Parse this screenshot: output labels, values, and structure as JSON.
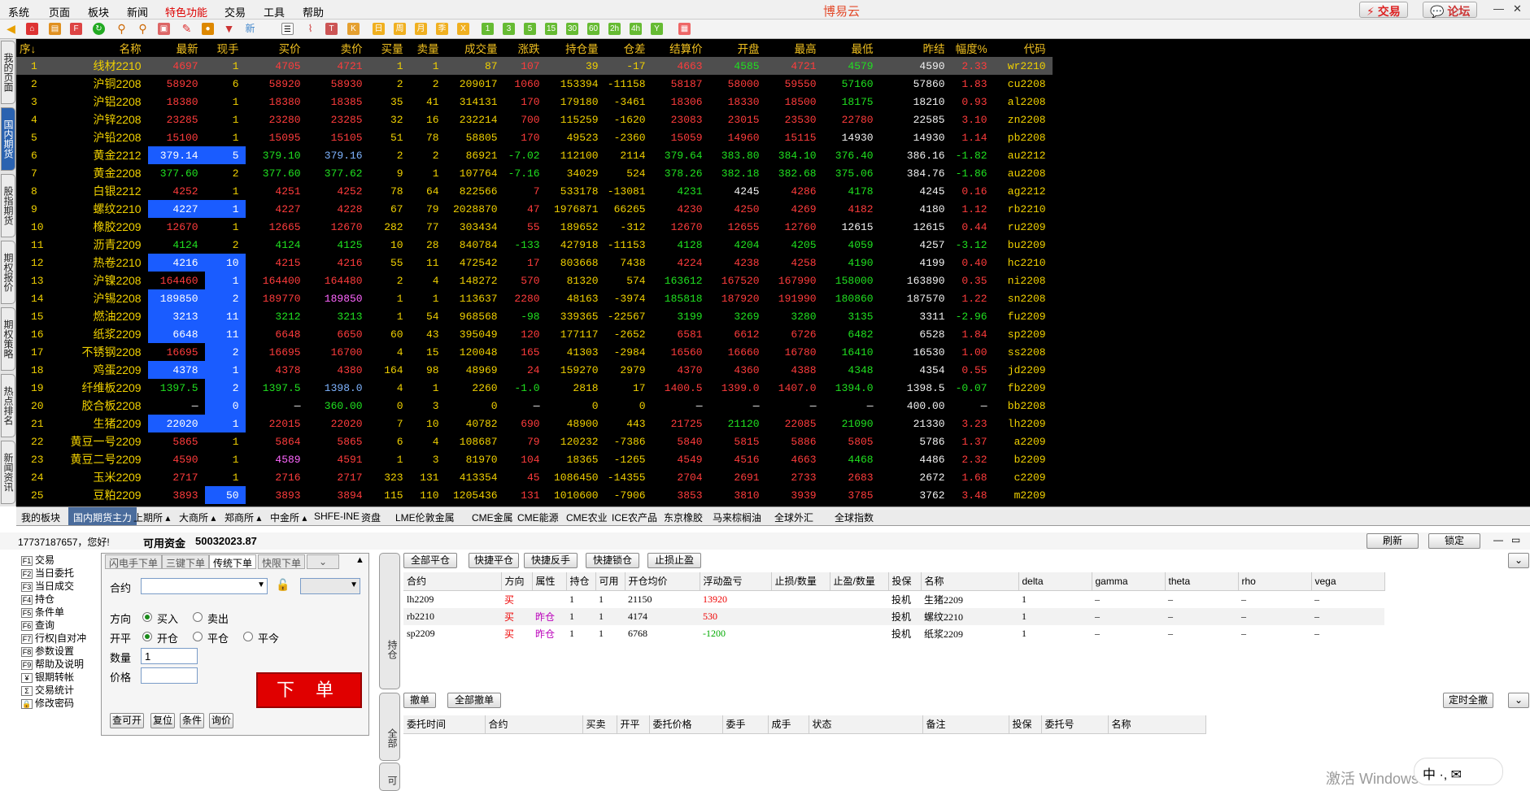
{
  "menu": [
    "系统",
    "页面",
    "板块",
    "新闻",
    "特色功能",
    "交易",
    "工具",
    "帮助"
  ],
  "app_title": "博易云",
  "top_buttons": {
    "trade": "⚡ 交易",
    "forum": "💬 论坛"
  },
  "toolbar_periods": [
    "1",
    "3",
    "5",
    "15",
    "30",
    "60",
    "2h",
    "4h",
    "Y"
  ],
  "toolbar_new": "新",
  "side_tabs": [
    "我的页面",
    "国内期货",
    "股指期货",
    "期权报价",
    "期权策略",
    "热点排名",
    "新闻资讯"
  ],
  "quote": {
    "headers": [
      "序↓",
      "名称",
      "最新",
      "现手",
      "买价",
      "卖价",
      "买量",
      "卖量",
      "成交量",
      "涨跌",
      "持仓量",
      "仓差",
      "结算价",
      "开盘",
      "最高",
      "最低",
      "昨结",
      "幅度%",
      "代码"
    ],
    "rows": [
      [
        "1",
        "线材2210",
        "4697",
        "1",
        "4705",
        "4721",
        "1",
        "1",
        "87",
        "107",
        "39",
        "-17",
        "4663",
        "4585",
        "4721",
        "4579",
        "4590",
        "2.33",
        "wr2210"
      ],
      [
        "2",
        "沪铜2208",
        "58920",
        "6",
        "58920",
        "58930",
        "2",
        "2",
        "209017",
        "1060",
        "153394",
        "-11158",
        "58187",
        "58000",
        "59550",
        "57160",
        "57860",
        "1.83",
        "cu2208"
      ],
      [
        "3",
        "沪铝2208",
        "18380",
        "1",
        "18380",
        "18385",
        "35",
        "41",
        "314131",
        "170",
        "179180",
        "-3461",
        "18306",
        "18330",
        "18500",
        "18175",
        "18210",
        "0.93",
        "al2208"
      ],
      [
        "4",
        "沪锌2208",
        "23285",
        "1",
        "23280",
        "23285",
        "32",
        "16",
        "232214",
        "700",
        "115259",
        "-1620",
        "23083",
        "23015",
        "23530",
        "22780",
        "22585",
        "3.10",
        "zn2208"
      ],
      [
        "5",
        "沪铅2208",
        "15100",
        "1",
        "15095",
        "15105",
        "51",
        "78",
        "58805",
        "170",
        "49523",
        "-2360",
        "15059",
        "14960",
        "15115",
        "14930",
        "14930",
        "1.14",
        "pb2208"
      ],
      [
        "6",
        "黄金2212",
        "379.14",
        "5",
        "379.10",
        "379.16",
        "2",
        "2",
        "86921",
        "-7.02",
        "112100",
        "2114",
        "379.64",
        "383.80",
        "384.10",
        "376.40",
        "386.16",
        "-1.82",
        "au2212"
      ],
      [
        "7",
        "黄金2208",
        "377.60",
        "2",
        "377.60",
        "377.62",
        "9",
        "1",
        "107764",
        "-7.16",
        "34029",
        "524",
        "378.26",
        "382.18",
        "382.68",
        "375.06",
        "384.76",
        "-1.86",
        "au2208"
      ],
      [
        "8",
        "白银2212",
        "4252",
        "1",
        "4251",
        "4252",
        "78",
        "64",
        "822566",
        "7",
        "533178",
        "-13081",
        "4231",
        "4245",
        "4286",
        "4178",
        "4245",
        "0.16",
        "ag2212"
      ],
      [
        "9",
        "螺纹2210",
        "4227",
        "1",
        "4227",
        "4228",
        "67",
        "79",
        "2028870",
        "47",
        "1976871",
        "66265",
        "4230",
        "4250",
        "4269",
        "4182",
        "4180",
        "1.12",
        "rb2210"
      ],
      [
        "10",
        "橡胶2209",
        "12670",
        "1",
        "12665",
        "12670",
        "282",
        "77",
        "303434",
        "55",
        "189652",
        "-312",
        "12670",
        "12655",
        "12760",
        "12615",
        "12615",
        "0.44",
        "ru2209"
      ],
      [
        "11",
        "沥青2209",
        "4124",
        "2",
        "4124",
        "4125",
        "10",
        "28",
        "840784",
        "-133",
        "427918",
        "-11153",
        "4128",
        "4204",
        "4205",
        "4059",
        "4257",
        "-3.12",
        "bu2209"
      ],
      [
        "12",
        "热卷2210",
        "4216",
        "10",
        "4215",
        "4216",
        "55",
        "11",
        "472542",
        "17",
        "803668",
        "7438",
        "4224",
        "4238",
        "4258",
        "4190",
        "4199",
        "0.40",
        "hc2210"
      ],
      [
        "13",
        "沪镍2208",
        "164460",
        "1",
        "164400",
        "164480",
        "2",
        "4",
        "148272",
        "570",
        "81320",
        "574",
        "163612",
        "167520",
        "167990",
        "158000",
        "163890",
        "0.35",
        "ni2208"
      ],
      [
        "14",
        "沪锡2208",
        "189850",
        "2",
        "189770",
        "189850",
        "1",
        "1",
        "113637",
        "2280",
        "48163",
        "-3974",
        "185818",
        "187920",
        "191990",
        "180860",
        "187570",
        "1.22",
        "sn2208"
      ],
      [
        "15",
        "燃油2209",
        "3213",
        "11",
        "3212",
        "3213",
        "1",
        "54",
        "968568",
        "-98",
        "339365",
        "-22567",
        "3199",
        "3269",
        "3280",
        "3135",
        "3311",
        "-2.96",
        "fu2209"
      ],
      [
        "16",
        "纸浆2209",
        "6648",
        "11",
        "6648",
        "6650",
        "60",
        "43",
        "395049",
        "120",
        "177117",
        "-2652",
        "6581",
        "6612",
        "6726",
        "6482",
        "6528",
        "1.84",
        "sp2209"
      ],
      [
        "17",
        "不锈钢2208",
        "16695",
        "2",
        "16695",
        "16700",
        "4",
        "15",
        "120048",
        "165",
        "41303",
        "-2984",
        "16560",
        "16660",
        "16780",
        "16410",
        "16530",
        "1.00",
        "ss2208"
      ],
      [
        "18",
        "鸡蛋2209",
        "4378",
        "1",
        "4378",
        "4380",
        "164",
        "98",
        "48969",
        "24",
        "159270",
        "2979",
        "4370",
        "4360",
        "4388",
        "4348",
        "4354",
        "0.55",
        "jd2209"
      ],
      [
        "19",
        "纤维板2209",
        "1397.5",
        "2",
        "1397.5",
        "1398.0",
        "4",
        "1",
        "2260",
        "-1.0",
        "2818",
        "17",
        "1400.5",
        "1399.0",
        "1407.0",
        "1394.0",
        "1398.5",
        "-0.07",
        "fb2209"
      ],
      [
        "20",
        "胶合板2208",
        "—",
        "0",
        "—",
        "360.00",
        "0",
        "3",
        "0",
        "—",
        "0",
        "0",
        "—",
        "—",
        "—",
        "—",
        "400.00",
        "—",
        "bb2208"
      ],
      [
        "21",
        "生猪2209",
        "22020",
        "1",
        "22015",
        "22020",
        "7",
        "10",
        "40782",
        "690",
        "48900",
        "443",
        "21725",
        "21120",
        "22085",
        "21090",
        "21330",
        "3.23",
        "lh2209"
      ],
      [
        "22",
        "黄豆一号2209",
        "5865",
        "1",
        "5864",
        "5865",
        "6",
        "4",
        "108687",
        "79",
        "120232",
        "-7386",
        "5840",
        "5815",
        "5886",
        "5805",
        "5786",
        "1.37",
        "a2209"
      ],
      [
        "23",
        "黄豆二号2209",
        "4590",
        "1",
        "4589",
        "4591",
        "1",
        "3",
        "81970",
        "104",
        "18365",
        "-1265",
        "4549",
        "4516",
        "4663",
        "4468",
        "4486",
        "2.32",
        "b2209"
      ],
      [
        "24",
        "玉米2209",
        "2717",
        "1",
        "2716",
        "2717",
        "323",
        "131",
        "413354",
        "45",
        "1086450",
        "-14355",
        "2704",
        "2691",
        "2733",
        "2683",
        "2672",
        "1.68",
        "c2209"
      ],
      [
        "25",
        "豆粕2209",
        "3893",
        "50",
        "3893",
        "3894",
        "115",
        "110",
        "1205436",
        "131",
        "1010600",
        "-7906",
        "3853",
        "3810",
        "3939",
        "3785",
        "3762",
        "3.48",
        "m2209"
      ]
    ]
  },
  "exchange_tabs": [
    "我的板块",
    "国内期货主力",
    "上期所 ▴",
    "大商所 ▴",
    "郑商所 ▴",
    "中金所 ▴",
    "SHFE-INE",
    "资盘",
    "LME伦敦金属",
    "CME金属",
    "CME能源",
    "CME农业",
    "ICE农产品",
    "东京橡胶",
    "马来棕榈油",
    "全球外汇",
    "全球指数"
  ],
  "account": {
    "greeting": "17737187657，您好!",
    "funds_label": "可用资金",
    "funds_value": "50032023.87",
    "refresh": "刷新",
    "lock": "锁定"
  },
  "left_nav": [
    {
      "key": "F1",
      "label": "交易"
    },
    {
      "key": "F2",
      "label": "当日委托"
    },
    {
      "key": "F3",
      "label": "当日成交"
    },
    {
      "key": "F4",
      "label": "持仓"
    },
    {
      "key": "F5",
      "label": "条件单"
    },
    {
      "key": "F6",
      "label": "查询"
    },
    {
      "key": "F7",
      "label": "行权|自对冲"
    },
    {
      "key": "F8",
      "label": "参数设置"
    },
    {
      "key": "F9",
      "label": "帮助及说明"
    },
    {
      "key": "¥",
      "label": "银期转帐"
    },
    {
      "key": "Σ",
      "label": "交易统计"
    },
    {
      "key": "🔒",
      "label": "修改密码"
    }
  ],
  "order": {
    "tabs": [
      "闪电手下单",
      "三键下单",
      "传统下单",
      "快限下单"
    ],
    "contract_label": "合约",
    "direction_label": "方向",
    "buy": "买入",
    "sell": "卖出",
    "openclose_label": "开平",
    "open": "开仓",
    "close": "平仓",
    "closetoday": "平今",
    "qty_label": "数量",
    "qty_value": "1",
    "price_label": "价格",
    "place": "下 单",
    "small_buttons": [
      "查可开",
      "复位",
      "条件",
      "询价"
    ]
  },
  "pos_vtab": "持仓",
  "ord_vtab": "全部",
  "ord_vtab2": "可",
  "pos_buttons": [
    "全部平仓",
    "快捷平仓",
    "快捷反手",
    "快捷锁仓",
    "止损止盈"
  ],
  "positions": {
    "headers": [
      "合约",
      "方向",
      "属性",
      "持仓",
      "可用",
      "开仓均价",
      "浮动盈亏",
      "止损/数量",
      "止盈/数量",
      "投保",
      "名称",
      "delta",
      "gamma",
      "theta",
      "rho",
      "vega"
    ],
    "rows": [
      [
        "lh2209",
        "买",
        "",
        "1",
        "1",
        "21150",
        "13920",
        "",
        "",
        "投机",
        "生猪2209",
        "1",
        "–",
        "–",
        "–",
        "–"
      ],
      [
        "rb2210",
        "买",
        "昨仓",
        "1",
        "1",
        "4174",
        "530",
        "",
        "",
        "投机",
        "螺纹2210",
        "1",
        "–",
        "–",
        "–",
        "–"
      ],
      [
        "sp2209",
        "买",
        "昨仓",
        "1",
        "1",
        "6768",
        "-1200",
        "",
        "",
        "投机",
        "纸浆2209",
        "1",
        "–",
        "–",
        "–",
        "–"
      ]
    ]
  },
  "order_buttons": [
    "撤单",
    "全部撤单"
  ],
  "timed_cancel": "定时全撤",
  "orders": {
    "headers": [
      "委托时间",
      "合约",
      "买卖",
      "开平",
      "委托价格",
      "委手",
      "成手",
      "状态",
      "备注",
      "投保",
      "委托号",
      "名称"
    ]
  },
  "watermark": "激活 Windows",
  "colors": {
    "quote_bg": "#000000",
    "up": "#ff3c3c",
    "down": "#20e020",
    "header": "#f0c020",
    "highlight": "#1a5cff"
  }
}
